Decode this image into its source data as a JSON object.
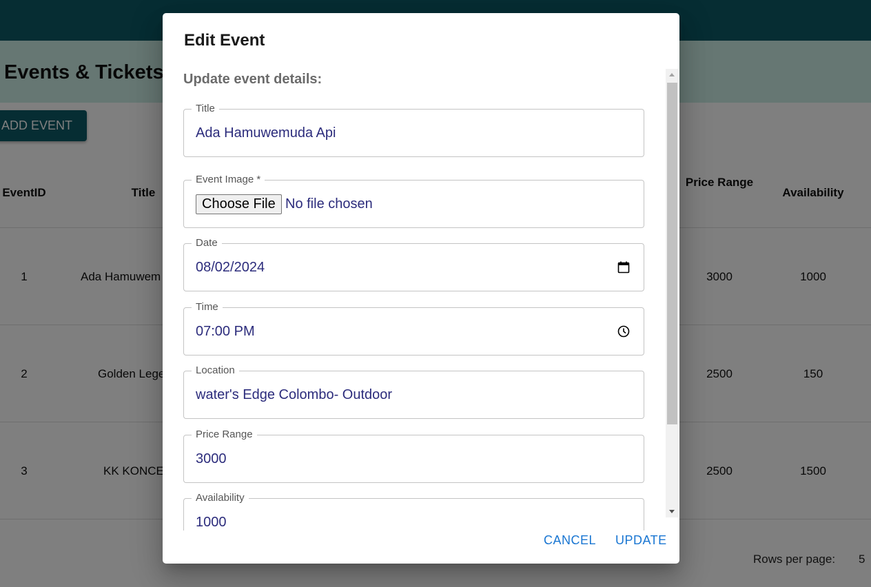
{
  "page": {
    "title": "Events & Tickets",
    "add_button": "ADD EVENT",
    "columns": {
      "event_id": "EventID",
      "title": "Title",
      "price_range": "Price Range",
      "availability": "Availability"
    },
    "rows": [
      {
        "id": "1",
        "title": "Ada Hamuwem",
        "price": "3000",
        "availability": "1000"
      },
      {
        "id": "2",
        "title": "Golden Lege",
        "price": "2500",
        "availability": "150"
      },
      {
        "id": "3",
        "title": "KK KONCE",
        "price": "2500",
        "availability": "1500"
      }
    ],
    "rows_per_page_label": "Rows per page:",
    "rows_per_page_value": "5"
  },
  "dialog": {
    "title": "Edit Event",
    "content_text": "Update event details:",
    "fields": {
      "title": {
        "label": "Title",
        "value": "Ada Hamuwemuda Api"
      },
      "image": {
        "label": "Event Image *",
        "button": "Choose File",
        "status": "No file chosen"
      },
      "date": {
        "label": "Date",
        "value": "08/02/2024",
        "icon": "calendar-icon"
      },
      "time": {
        "label": "Time",
        "value": "07:00 PM",
        "icon": "clock-icon"
      },
      "location": {
        "label": "Location",
        "value": "water's Edge Colombo- Outdoor"
      },
      "price": {
        "label": "Price Range",
        "value": "3000"
      },
      "availability": {
        "label": "Availability",
        "value": "1000"
      }
    },
    "cancel_label": "CANCEL",
    "update_label": "UPDATE"
  },
  "colors": {
    "topbar": "#0d5a66",
    "header": "#cdeee6",
    "accent": "#1976d2",
    "input_text": "#2c2c7c"
  }
}
